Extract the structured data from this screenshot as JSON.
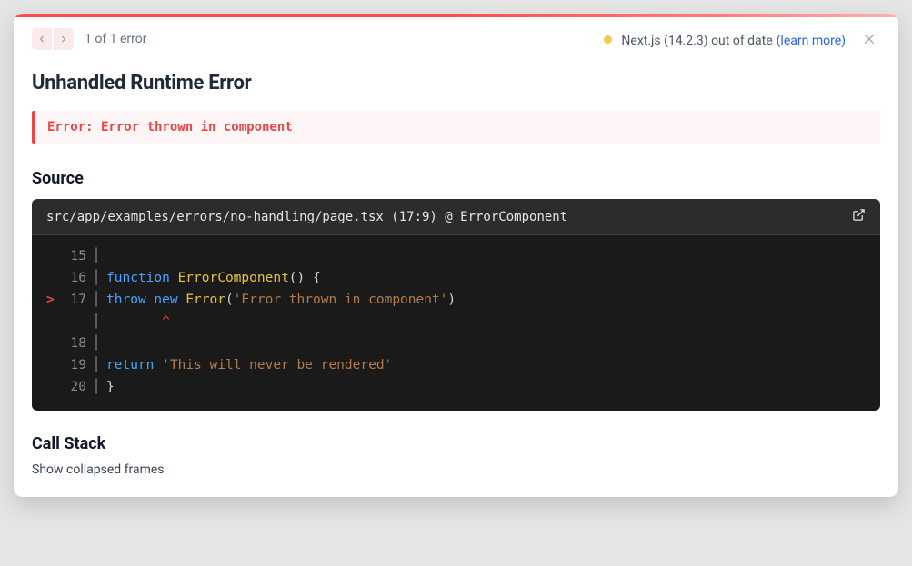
{
  "header": {
    "error_counter": "1 of 1 error",
    "version_status": "Next.js (14.2.3) out of date",
    "learn_more": "(learn more)"
  },
  "title": "Unhandled Runtime Error",
  "error_message": "Error: Error thrown in component",
  "source": {
    "heading": "Source",
    "file_location": "src/app/examples/errors/no-handling/page.tsx (17:9) @ ErrorComponent",
    "code": {
      "line15": {
        "num": "15",
        "content": ""
      },
      "line16": {
        "num": "16",
        "kw": "function",
        "fn": "ErrorComponent",
        "rest": "() {"
      },
      "line17": {
        "num": "17",
        "kw1": "throw",
        "kw2": "new",
        "fn": "Error",
        "paren_open": "(",
        "str": "'Error thrown in component'",
        "paren_close": ")"
      },
      "caret": "       ^",
      "line18": {
        "num": "18",
        "content": ""
      },
      "line19": {
        "num": "19",
        "kw": "return",
        "str": "'This will never be rendered'"
      },
      "line20": {
        "num": "20",
        "content": "}"
      }
    }
  },
  "call_stack": {
    "heading": "Call Stack",
    "toggle": "Show collapsed frames"
  }
}
